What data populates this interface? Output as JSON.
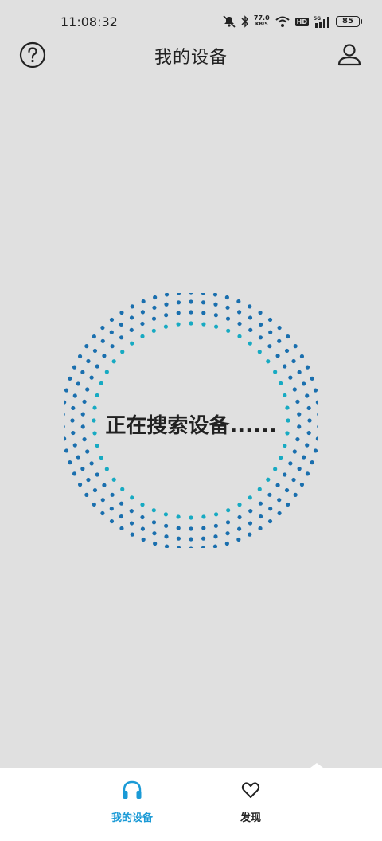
{
  "status_bar": {
    "time": "11:08:32",
    "net_speed_value": "77.0",
    "net_speed_unit": "KB/S",
    "hd_label": "HD",
    "network_label": "5G",
    "battery": "85"
  },
  "header": {
    "title": "我的设备",
    "help_icon": "question-circle-icon",
    "profile_icon": "user-icon"
  },
  "scanner": {
    "status_text": "正在搜索设备......",
    "colors": {
      "inner": "#17aac2",
      "outer": "#1a6fae"
    }
  },
  "bottom_nav": {
    "items": [
      {
        "label": "我的设备",
        "icon": "headphones-icon",
        "active": true
      },
      {
        "label": "发现",
        "icon": "heart-icon",
        "active": false
      }
    ],
    "active_color": "#1a9ad6"
  }
}
